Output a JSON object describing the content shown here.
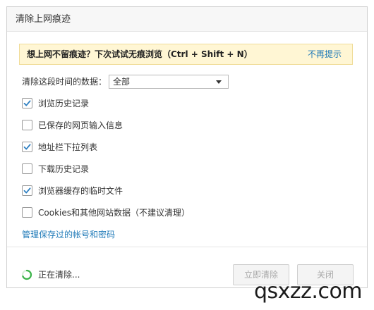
{
  "dialog": {
    "title": "清除上网痕迹",
    "tip": {
      "text": "想上网不留痕迹？下次试试无痕浏览（Ctrl + Shift + N）",
      "dismiss": "不再提示"
    },
    "range": {
      "label": "清除这段时间的数据：",
      "selected": "全部"
    },
    "options": [
      {
        "label": "浏览历史记录",
        "checked": true
      },
      {
        "label": "已保存的网页输入信息",
        "checked": false
      },
      {
        "label": "地址栏下拉列表",
        "checked": true
      },
      {
        "label": "下载历史记录",
        "checked": false
      },
      {
        "label": "浏览器缓存的临时文件",
        "checked": true
      },
      {
        "label": "Cookies和其他网站数据（不建议清理）",
        "checked": false
      }
    ],
    "manage_link": "管理保存过的帐号和密码",
    "status": "正在清除...",
    "buttons": {
      "clear": "立即清除",
      "close": "关闭"
    }
  },
  "watermark": "qsxzz.com",
  "colors": {
    "accent": "#1f7ab8",
    "check": "#2d7fc1",
    "tip_bg": "#fff6d4",
    "spinner": "#3cb34a"
  }
}
